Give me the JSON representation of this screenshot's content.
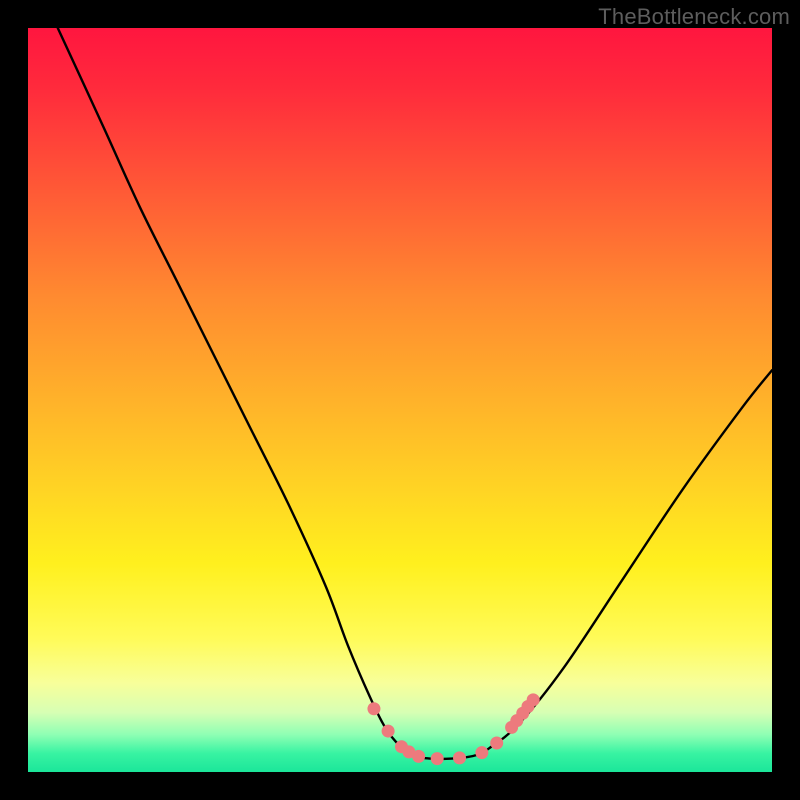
{
  "watermark": "TheBottleneck.com",
  "chart_data": {
    "type": "line",
    "title": "",
    "xlabel": "",
    "ylabel": "",
    "xlim": [
      0,
      100
    ],
    "ylim": [
      0,
      100
    ],
    "series": [
      {
        "name": "curve",
        "x": [
          4,
          10,
          15,
          20,
          25,
          30,
          35,
          40,
          43,
          46,
          48,
          50,
          52,
          54,
          57,
          60,
          62,
          66,
          72,
          80,
          88,
          96,
          100
        ],
        "y": [
          100,
          87,
          76,
          66,
          56,
          46,
          36,
          25,
          17,
          10,
          6,
          3.5,
          2.2,
          1.8,
          1.8,
          2.2,
          3.2,
          6.5,
          14,
          26,
          38,
          49,
          54
        ]
      }
    ],
    "markers": {
      "name": "pink-dots",
      "color": "#ed7a7d",
      "points": [
        {
          "x": 46.5,
          "y": 8.5
        },
        {
          "x": 48.4,
          "y": 5.5
        },
        {
          "x": 50.2,
          "y": 3.4
        },
        {
          "x": 51.2,
          "y": 2.7
        },
        {
          "x": 52.5,
          "y": 2.1
        },
        {
          "x": 55.0,
          "y": 1.8
        },
        {
          "x": 58.0,
          "y": 1.9
        },
        {
          "x": 61.0,
          "y": 2.6
        },
        {
          "x": 63.0,
          "y": 3.9
        },
        {
          "x": 65.0,
          "y": 6.0
        },
        {
          "x": 65.7,
          "y": 6.9
        },
        {
          "x": 66.5,
          "y": 7.9
        },
        {
          "x": 67.2,
          "y": 8.8
        },
        {
          "x": 67.9,
          "y": 9.7
        }
      ]
    },
    "gradient_stops": [
      {
        "pos": 0.0,
        "color": "#ff163f"
      },
      {
        "pos": 0.5,
        "color": "#ffb22a"
      },
      {
        "pos": 0.82,
        "color": "#fffb58"
      },
      {
        "pos": 0.95,
        "color": "#8effb4"
      },
      {
        "pos": 1.0,
        "color": "#1be69a"
      }
    ]
  }
}
